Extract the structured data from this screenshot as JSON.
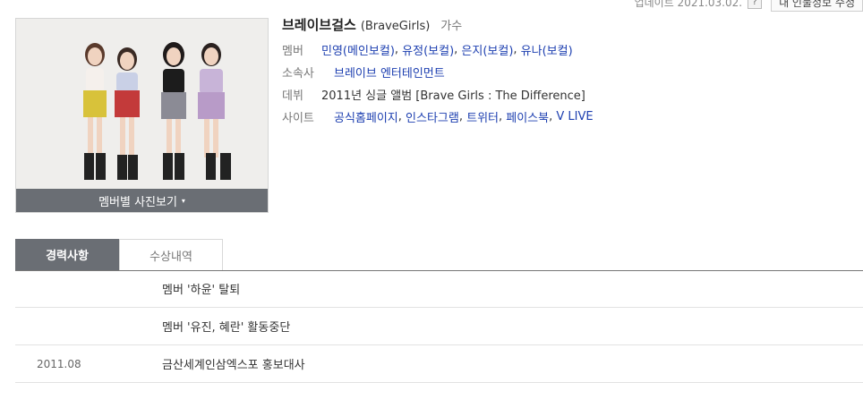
{
  "header": {
    "updated": "업데이트 2021.03.02.",
    "help_icon": "?",
    "edit_button": "내 인물정보 수정"
  },
  "profile": {
    "photo_button": "멤버별 사진보기",
    "caret": "▾",
    "name_ko": "브레이브걸스",
    "name_en": "(BraveGirls)",
    "role": "가수",
    "members_label": "멤버",
    "members": [
      "민영(메인보컬)",
      "유정(보컬)",
      "은지(보컬)",
      "유나(보컬)"
    ],
    "agency_label": "소속사",
    "agency": "브레이브 엔터테인먼트",
    "debut_label": "데뷔",
    "debut": "2011년 싱글 앨범 [Brave Girls : The Difference]",
    "site_label": "사이트",
    "sites": [
      "공식홈페이지",
      "인스타그램",
      "트위터",
      "페이스북",
      "V LIVE"
    ]
  },
  "tabs": {
    "career": "경력사항",
    "awards": "수상내역"
  },
  "history": [
    {
      "date": "",
      "text": "멤버 '하윤' 탈퇴"
    },
    {
      "date": "",
      "text": "멤버 '유진, 혜란' 활동중단"
    },
    {
      "date": "2011.08",
      "text": "금산세계인삼엑스포 홍보대사"
    }
  ],
  "colors": {
    "link": "#1d3fb0",
    "tab_active": "#6a6e74"
  }
}
